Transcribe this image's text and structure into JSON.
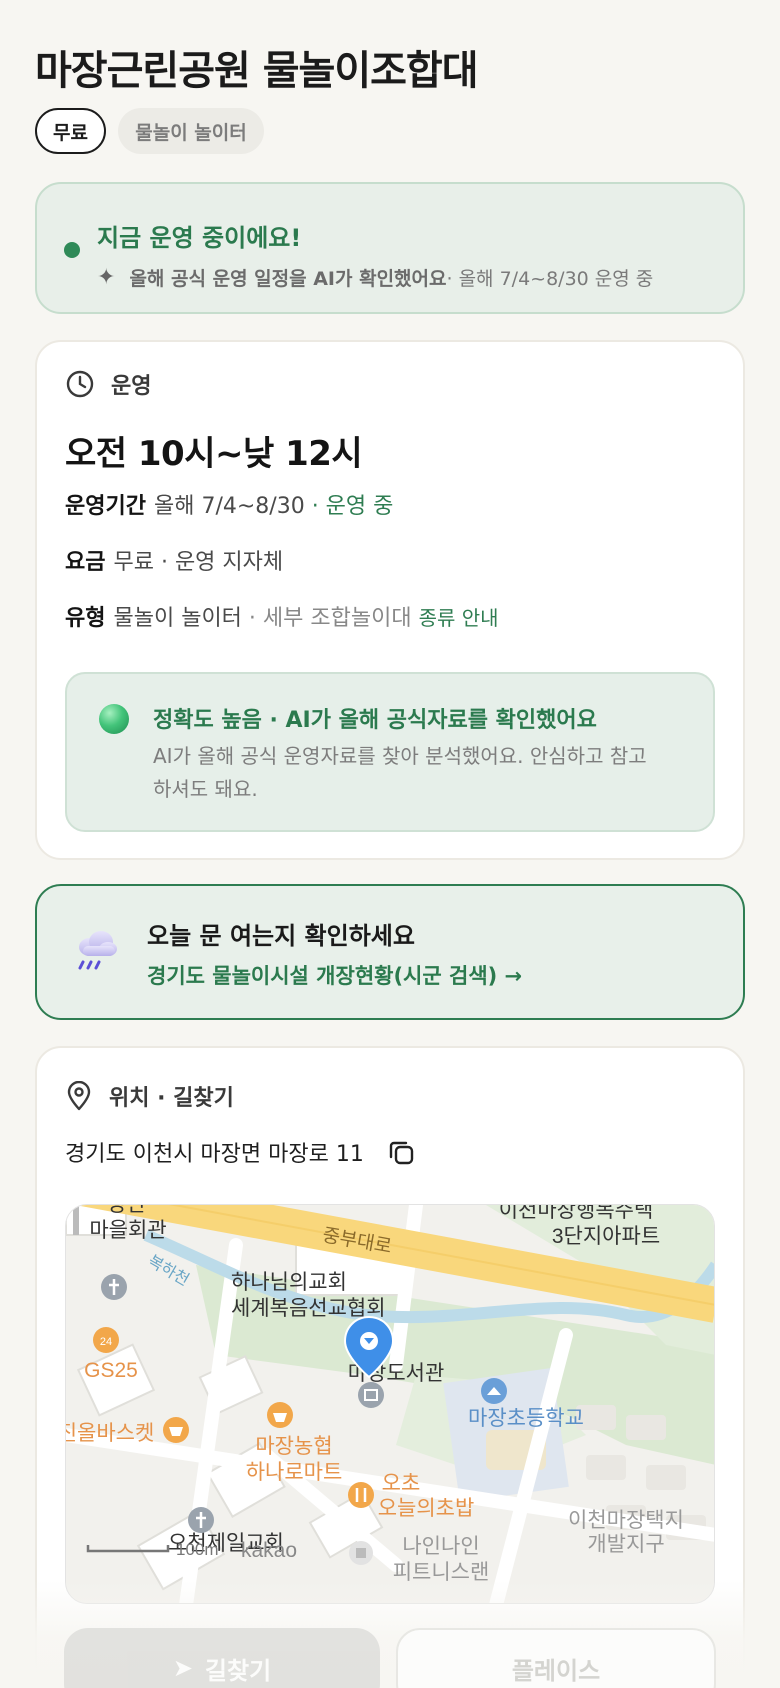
{
  "title": "마장근린공원 물놀이조합대",
  "chips": {
    "free": "무료",
    "type": "물놀이 놀이터"
  },
  "status": {
    "title": "지금 운영 중이에요!",
    "sub_bold": "올해 공식 운영 일정을 AI가 확인했어요",
    "sub_rest": " · 올해 7/4~8/30 운영 중",
    "accent_color": "#2b7a4e"
  },
  "operation": {
    "section_label": "운영",
    "hours": "오전 10시~낮 12시",
    "period_label": "운영기간",
    "period_value": "올해 7/4~8/30",
    "period_status": "· 운영 중",
    "fee_label": "요금",
    "fee_value": "무료 · 운영 지자체",
    "type_label": "유형",
    "type_value": "물놀이 놀이터",
    "type_detail": " · 세부 조합놀이대 ",
    "type_link": "종류 안내"
  },
  "accuracy": {
    "title": "정확도 높음 · AI가 올해 공식자료를 확인했어요",
    "body": "AI가 올해 공식 운영자료를 찾아 분석했어요. 안심하고 참고하셔도 돼요."
  },
  "notice": {
    "title": "오늘 문 여는지 확인하세요",
    "link": "경기도 물놀이시설 개장현황(시군 검색) →"
  },
  "location": {
    "section_label": "위치 · 길찾기",
    "address": "경기도 이천시 마장면 마장로 11"
  },
  "map": {
    "labels": {
      "apartment1": "이천마장행복주택",
      "apartment2": "3단지아파트",
      "hall1": "청년",
      "hall2": "마을회관",
      "road": "중부대로",
      "stream": "복하천",
      "church1": "하나님의교회",
      "church2": "세계복음선교협회",
      "gs25": "GS25",
      "library": "마장도서관",
      "school": "마장초등학교",
      "basket": "진올바스켓",
      "nh1": "마장농협",
      "nh2": "하나로마트",
      "ochon1": "오초",
      "ochon2": "오늘의초밥",
      "church3": "오천제일교회",
      "fitness1": "나인나인",
      "fitness2": "피트니스랜",
      "district1": "이천마장택지",
      "district2": "개발지구",
      "scale": "100m",
      "brand": "kakao"
    }
  },
  "buttons": {
    "directions": "길찾기",
    "place": "플레이스"
  }
}
